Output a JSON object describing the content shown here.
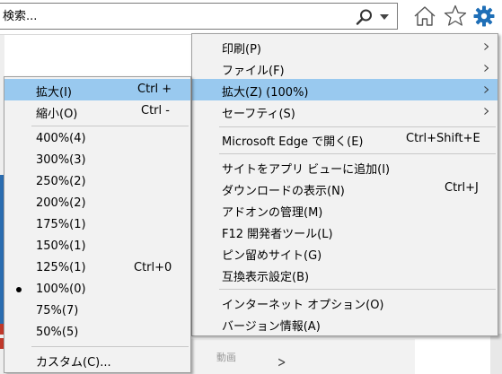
{
  "toolbar": {
    "search_placeholder": "検索..."
  },
  "background": {
    "footer_text": "動画"
  },
  "main_menu": {
    "items": [
      {
        "label": "印刷(P)",
        "has_submenu": true
      },
      {
        "label": "ファイル(F)",
        "has_submenu": true
      },
      {
        "label": "拡大(Z) (100%)",
        "has_submenu": true,
        "highlighted": true
      },
      {
        "label": "セーフティ(S)",
        "has_submenu": true
      },
      {
        "label": "Microsoft Edge で開く(E)",
        "shortcut": "Ctrl+Shift+E"
      },
      {
        "label": "サイトをアプリ ビューに追加(I)"
      },
      {
        "label": "ダウンロードの表示(N)",
        "shortcut": "Ctrl+J"
      },
      {
        "label": "アドオンの管理(M)"
      },
      {
        "label": "F12 開発者ツール(L)"
      },
      {
        "label": "ピン留めサイト(G)"
      },
      {
        "label": "互換表示設定(B)"
      },
      {
        "label": "インターネット オプション(O)"
      },
      {
        "label": "バージョン情報(A)"
      }
    ]
  },
  "zoom_menu": {
    "items": [
      {
        "label": "拡大(I)",
        "shortcut": "Ctrl +",
        "highlighted": true
      },
      {
        "label": "縮小(O)",
        "shortcut": "Ctrl -"
      },
      {
        "label": "400%(4)"
      },
      {
        "label": "300%(3)"
      },
      {
        "label": "250%(2)"
      },
      {
        "label": "200%(2)"
      },
      {
        "label": "175%(1)"
      },
      {
        "label": "150%(1)"
      },
      {
        "label": "125%(1)",
        "shortcut": "Ctrl+0"
      },
      {
        "label": "100%(0)",
        "selected": true
      },
      {
        "label": "75%(7)"
      },
      {
        "label": "50%(5)"
      },
      {
        "label": "カスタム(C)..."
      }
    ]
  },
  "colors": {
    "highlight": "#99c9ef",
    "menu_background": "#f2f2f2",
    "gear_accent": "#1f6fb7"
  },
  "icons": [
    "search-icon",
    "search-dropdown-icon",
    "home-icon",
    "star-icon",
    "gear-icon"
  ]
}
